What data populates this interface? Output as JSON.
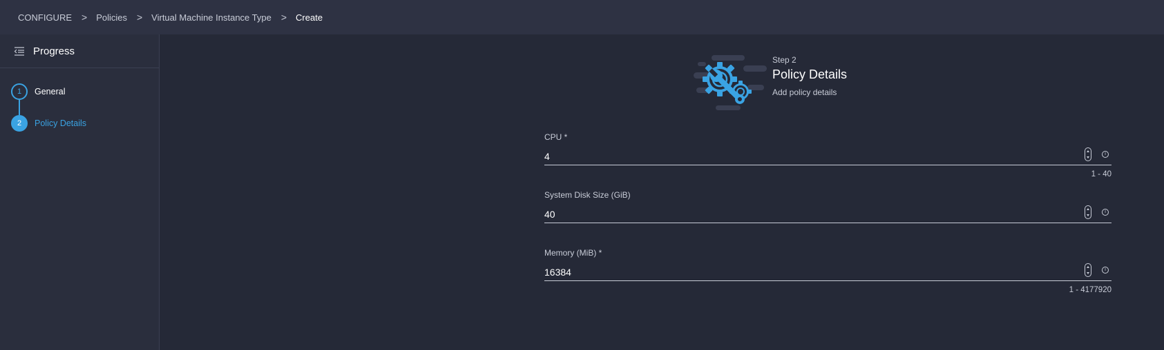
{
  "breadcrumb": {
    "items": [
      "CONFIGURE",
      "Policies",
      "Virtual Machine Instance Type",
      "Create"
    ],
    "separator": ">"
  },
  "sidebar": {
    "title": "Progress",
    "steps": [
      {
        "number": "1",
        "label": "General",
        "state": "completed"
      },
      {
        "number": "2",
        "label": "Policy Details",
        "state": "active"
      }
    ]
  },
  "step_header": {
    "step": "Step 2",
    "title": "Policy Details",
    "subtitle": "Add policy details",
    "icon": "gear-wrench-icon"
  },
  "form": {
    "fields": [
      {
        "label": "CPU *",
        "value": "4",
        "range": "1 - 40"
      },
      {
        "label": "System Disk Size (GiB)",
        "value": "40",
        "range": ""
      },
      {
        "label": "Memory (MiB) *",
        "value": "16384",
        "range": "1 - 4177920"
      }
    ]
  },
  "colors": {
    "accent": "#3aa3e3",
    "background": "#252937",
    "topbar": "#2e3243",
    "sidebar": "#2a2e3d"
  }
}
